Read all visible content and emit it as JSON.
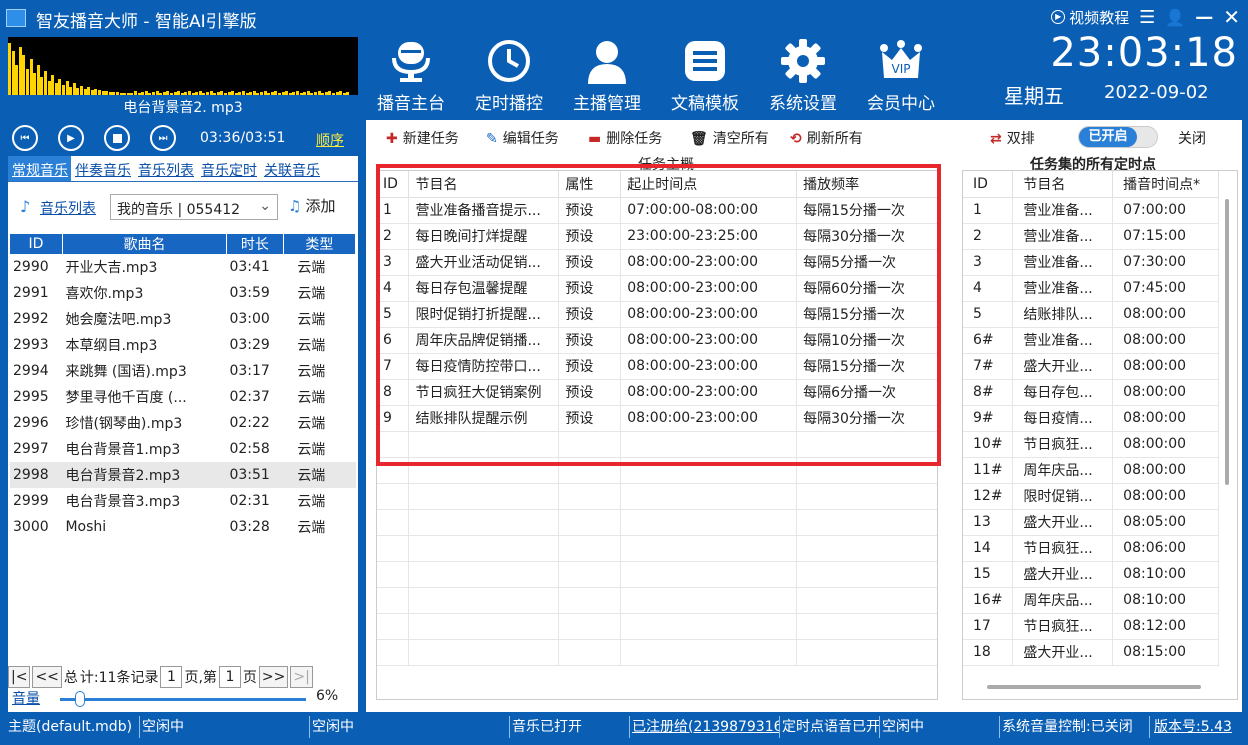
{
  "window": {
    "title": "智友播音大师 - 智能AI引擎版",
    "tutorial_label": "视频教程"
  },
  "now_playing": "电台背景音2. mp3",
  "nav": [
    {
      "label": "播音主台",
      "icon": "microphone-icon"
    },
    {
      "label": "定时播控",
      "icon": "clock-icon"
    },
    {
      "label": "主播管理",
      "icon": "user-icon"
    },
    {
      "label": "文稿模板",
      "icon": "document-list-icon"
    },
    {
      "label": "系统设置",
      "icon": "gear-icon"
    },
    {
      "label": "会员中心",
      "icon": "vip-crown-icon"
    }
  ],
  "clock": {
    "time": "23:03:18",
    "weekday": "星期五",
    "date": "2022-09-02"
  },
  "player": {
    "time": "03:36/03:51",
    "mode": "顺序"
  },
  "left_tabs": [
    "常规音乐",
    "伴奏音乐",
    "音乐列表",
    "音乐定时",
    "关联音乐"
  ],
  "music_selector": {
    "label": "音乐列表",
    "value": "我的音乐 | 055412",
    "add_label": "添加"
  },
  "song_columns": [
    "ID",
    "歌曲名",
    "时长",
    "类型"
  ],
  "songs": [
    {
      "id": "2990",
      "name": "开业大吉.mp3",
      "duration": "03:41",
      "type": "云端"
    },
    {
      "id": "2991",
      "name": "喜欢你.mp3",
      "duration": "03:59",
      "type": "云端"
    },
    {
      "id": "2992",
      "name": "她会魔法吧.mp3",
      "duration": "03:00",
      "type": "云端"
    },
    {
      "id": "2993",
      "name": "本草纲目.mp3",
      "duration": "03:29",
      "type": "云端"
    },
    {
      "id": "2994",
      "name": "来跳舞 (国语).mp3",
      "duration": "03:17",
      "type": "云端"
    },
    {
      "id": "2995",
      "name": "梦里寻他千百度 (...",
      "duration": "02:37",
      "type": "云端"
    },
    {
      "id": "2996",
      "name": "珍惜(钢琴曲).mp3",
      "duration": "02:22",
      "type": "云端"
    },
    {
      "id": "2997",
      "name": "电台背景音1.mp3",
      "duration": "02:58",
      "type": "云端"
    },
    {
      "id": "2998",
      "name": "电台背景音2.mp3",
      "duration": "03:51",
      "type": "云端"
    },
    {
      "id": "2999",
      "name": "电台背景音3.mp3",
      "duration": "02:31",
      "type": "云端"
    },
    {
      "id": "3000",
      "name": "Moshi",
      "duration": "03:28",
      "type": "云端"
    }
  ],
  "pager": {
    "total_label": "总",
    "count_label": "计:11条记录",
    "page": "1",
    "page_label": "页,第",
    "page_of": "1",
    "page_suffix": "页"
  },
  "volume": {
    "label": "音量",
    "percent": "6%",
    "level": 0.06
  },
  "toolbar": {
    "new_task": "新建任务",
    "edit_task": "编辑任务",
    "delete_task": "删除任务",
    "clear_all": "清空所有",
    "refresh_all": "刷新所有",
    "double_label": "双排",
    "toggle_on": "已开启",
    "close_label": "关闭"
  },
  "task_panel_title": "任务主概",
  "task_columns": [
    "ID",
    "节目名",
    "属性",
    "起止时间点",
    "播放频率"
  ],
  "tasks": [
    {
      "id": "1",
      "name": "营业准备播音提示...",
      "attr": "预设",
      "time": "07:00:00-08:00:00",
      "freq": "每隔15分播一次"
    },
    {
      "id": "2",
      "name": "每日晚间打烊提醒",
      "attr": "预设",
      "time": "23:00:00-23:25:00",
      "freq": "每隔30分播一次"
    },
    {
      "id": "3",
      "name": "盛大开业活动促销...",
      "attr": "预设",
      "time": "08:00:00-23:00:00",
      "freq": "每隔5分播一次"
    },
    {
      "id": "4",
      "name": "每日存包温馨提醒",
      "attr": "预设",
      "time": "08:00:00-23:00:00",
      "freq": "每隔60分播一次"
    },
    {
      "id": "5",
      "name": "限时促销打折提醒...",
      "attr": "预设",
      "time": "08:00:00-23:00:00",
      "freq": "每隔15分播一次"
    },
    {
      "id": "6",
      "name": "周年庆品牌促销播...",
      "attr": "预设",
      "time": "08:00:00-23:00:00",
      "freq": "每隔10分播一次"
    },
    {
      "id": "7",
      "name": "每日疫情防控带口...",
      "attr": "预设",
      "time": "08:00:00-23:00:00",
      "freq": "每隔15分播一次"
    },
    {
      "id": "8",
      "name": "节日疯狂大促销案例",
      "attr": "预设",
      "time": "08:00:00-23:00:00",
      "freq": "每隔6分播一次"
    },
    {
      "id": "9",
      "name": "结账排队提醒示例",
      "attr": "预设",
      "time": "08:00:00-23:00:00",
      "freq": "每隔30分播一次"
    }
  ],
  "schedule_title": "任务集的所有定时点",
  "schedule_columns": [
    "ID",
    "节目名",
    "播音时间点*"
  ],
  "schedule": [
    {
      "id": "1",
      "name": "营业准备...",
      "time": "07:00:00"
    },
    {
      "id": "2",
      "name": "营业准备...",
      "time": "07:15:00"
    },
    {
      "id": "3",
      "name": "营业准备...",
      "time": "07:30:00"
    },
    {
      "id": "4",
      "name": "营业准备...",
      "time": "07:45:00"
    },
    {
      "id": "5",
      "name": "结账排队...",
      "time": "08:00:00"
    },
    {
      "id": "6#",
      "name": "营业准备...",
      "time": "08:00:00"
    },
    {
      "id": "7#",
      "name": "盛大开业...",
      "time": "08:00:00"
    },
    {
      "id": "8#",
      "name": "每日存包...",
      "time": "08:00:00"
    },
    {
      "id": "9#",
      "name": "每日疫情...",
      "time": "08:00:00"
    },
    {
      "id": "10#",
      "name": "节日疯狂...",
      "time": "08:00:00"
    },
    {
      "id": "11#",
      "name": "周年庆品...",
      "time": "08:00:00"
    },
    {
      "id": "12#",
      "name": "限时促销...",
      "time": "08:00:00"
    },
    {
      "id": "13",
      "name": "盛大开业...",
      "time": "08:05:00"
    },
    {
      "id": "14",
      "name": "节日疯狂...",
      "time": "08:06:00"
    },
    {
      "id": "15",
      "name": "盛大开业...",
      "time": "08:10:00"
    },
    {
      "id": "16#",
      "name": "周年庆品...",
      "time": "08:10:00"
    },
    {
      "id": "17",
      "name": "节日疯狂...",
      "time": "08:12:00"
    },
    {
      "id": "18",
      "name": "盛大开业...",
      "time": "08:15:00"
    }
  ],
  "status": [
    "主题(default.mdb)",
    "空闲中",
    "空闲中",
    "音乐已打开",
    "已注册给(2139879316",
    "定时点语音已开",
    "空闲中",
    "系统音量控制:已关闭",
    "版本号:5.43"
  ],
  "colors": {
    "primary": "#0a5fb4",
    "highlight_box": "#e8262e",
    "spectrum": "#ffd400"
  }
}
